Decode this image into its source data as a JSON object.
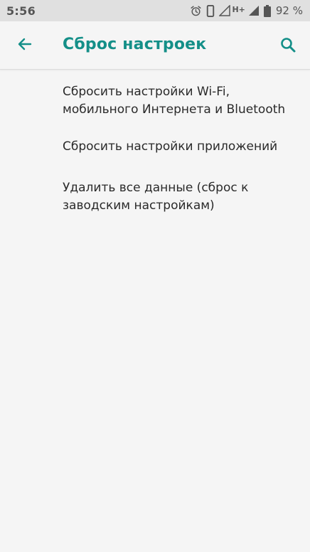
{
  "status_bar": {
    "time": "5:56",
    "network_type": "H+",
    "battery_percent": "92 %",
    "icons": [
      "alarm-icon",
      "vibrate-icon",
      "signal-empty-icon",
      "signal-icon",
      "battery-icon"
    ]
  },
  "app_bar": {
    "title": "Сброс настроек",
    "icons": [
      "back-arrow-icon",
      "search-icon"
    ]
  },
  "options": [
    {
      "label": "Сбросить настройки Wi-Fi, мобильного Интернета и Bluetooth"
    },
    {
      "label": "Сбросить настройки приложений"
    },
    {
      "label": "Удалить все данные (сброс к заводским настройкам)"
    }
  ],
  "colors": {
    "accent": "#148f88",
    "background": "#f5f5f5",
    "status_bar": "#e0e0e0",
    "text": "#2a2a2a"
  }
}
